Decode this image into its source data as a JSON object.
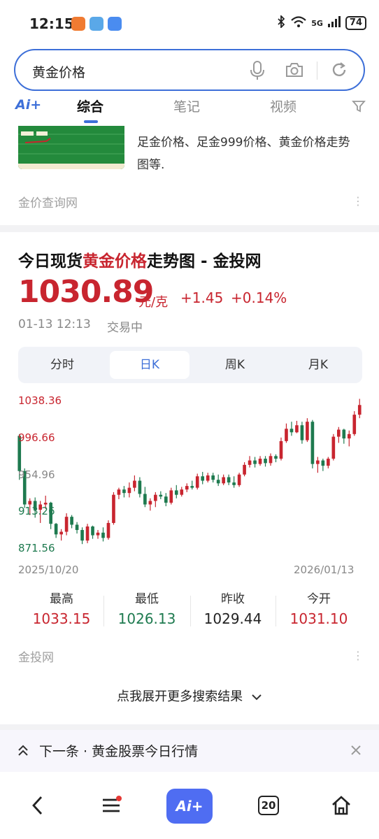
{
  "status_bar": {
    "time": "12:15",
    "network": "5G",
    "battery": "74"
  },
  "search": {
    "query": "黄金价格"
  },
  "tabs": {
    "ai_label": "Ai+",
    "items": [
      "综合",
      "笔记",
      "视频"
    ]
  },
  "card1": {
    "snippet": "足金价格、足金999价格、黄金价格走势图等.",
    "source": "金价查询网"
  },
  "card2": {
    "title_prefix": "今日现货",
    "title_highlight": "黄金价格",
    "title_suffix": "走势图 - 金投网",
    "price": "1030.89",
    "unit": "元/克",
    "change": "+1.45",
    "change_pct": "+0.14%",
    "timestamp": "01-13 12:13",
    "trade_status": "交易中",
    "periods": [
      "分时",
      "日K",
      "周K",
      "月K"
    ],
    "active_period": "日K",
    "start_date": "2025/10/20",
    "end_date": "2026/01/13",
    "stats": [
      {
        "label": "最高",
        "value": "1033.15",
        "color": "#c8252f"
      },
      {
        "label": "最低",
        "value": "1026.13",
        "color": "#1e7a4f"
      },
      {
        "label": "昨收",
        "value": "1029.44",
        "color": "#222222"
      },
      {
        "label": "今开",
        "value": "1031.10",
        "color": "#c8252f"
      }
    ],
    "source": "金投网",
    "expand_label": "点我展开更多搜索结果"
  },
  "next": {
    "label": "下一条 · 黄金股票今日行情"
  },
  "bottom_nav": {
    "ai_label": "Ai+",
    "tab_count": "20"
  },
  "colors": {
    "up": "#c8252f",
    "down": "#1e7a4f",
    "accent": "#3d6fd8"
  },
  "chart_data": {
    "type": "candlestick",
    "y_ticks": [
      "1038.36",
      "996.66",
      "954.96",
      "913.26",
      "871.56"
    ],
    "ylim": [
      871.56,
      1038.36
    ],
    "x_start": "2025/10/20",
    "x_end": "2026/01/13",
    "candles": [
      [
        996,
        998,
        946,
        956
      ],
      [
        956,
        959,
        914,
        918
      ],
      [
        918,
        925,
        906,
        922
      ],
      [
        922,
        926,
        903,
        912
      ],
      [
        912,
        922,
        897,
        918
      ],
      [
        918,
        928,
        913,
        920
      ],
      [
        920,
        921,
        890,
        896
      ],
      [
        896,
        897,
        880,
        884
      ],
      [
        884,
        890,
        877,
        887
      ],
      [
        887,
        908,
        883,
        904
      ],
      [
        904,
        906,
        891,
        895
      ],
      [
        895,
        898,
        885,
        889
      ],
      [
        889,
        892,
        873,
        877
      ],
      [
        877,
        896,
        874,
        893
      ],
      [
        893,
        894,
        879,
        883
      ],
      [
        883,
        889,
        879,
        886
      ],
      [
        886,
        892,
        876,
        880
      ],
      [
        880,
        900,
        878,
        897
      ],
      [
        897,
        932,
        895,
        929
      ],
      [
        929,
        937,
        924,
        935
      ],
      [
        935,
        939,
        926,
        931
      ],
      [
        931,
        943,
        926,
        937
      ],
      [
        937,
        951,
        933,
        945
      ],
      [
        945,
        949,
        926,
        930
      ],
      [
        930,
        938,
        915,
        918
      ],
      [
        918,
        925,
        911,
        922
      ],
      [
        922,
        932,
        915,
        929
      ],
      [
        929,
        933,
        924,
        927
      ],
      [
        927,
        931,
        916,
        920
      ],
      [
        920,
        937,
        918,
        934
      ],
      [
        934,
        940,
        925,
        929
      ],
      [
        929,
        938,
        927,
        935
      ],
      [
        935,
        942,
        932,
        939
      ],
      [
        939,
        945,
        935,
        937
      ],
      [
        937,
        953,
        935,
        950
      ],
      [
        950,
        955,
        941,
        945
      ],
      [
        945,
        954,
        943,
        951
      ],
      [
        951,
        954,
        943,
        946
      ],
      [
        946,
        952,
        939,
        942
      ],
      [
        942,
        952,
        940,
        949
      ],
      [
        949,
        952,
        940,
        943
      ],
      [
        943,
        950,
        937,
        940
      ],
      [
        940,
        954,
        938,
        952
      ],
      [
        952,
        966,
        950,
        963
      ],
      [
        963,
        973,
        960,
        968
      ],
      [
        968,
        972,
        960,
        964
      ],
      [
        964,
        973,
        962,
        970
      ],
      [
        970,
        973,
        961,
        965
      ],
      [
        965,
        976,
        962,
        973
      ],
      [
        973,
        975,
        966,
        970
      ],
      [
        970,
        994,
        968,
        990
      ],
      [
        990,
        1010,
        988,
        1004
      ],
      [
        1004,
        1012,
        996,
        1000
      ],
      [
        1000,
        1013,
        999,
        1008
      ],
      [
        1008,
        1012,
        987,
        991
      ],
      [
        991,
        1016,
        989,
        1012
      ],
      [
        1012,
        1014,
        959,
        964
      ],
      [
        964,
        972,
        954,
        968
      ],
      [
        968,
        970,
        956,
        962
      ],
      [
        962,
        972,
        959,
        970
      ],
      [
        970,
        998,
        968,
        995
      ],
      [
        995,
        1006,
        988,
        1003
      ],
      [
        1003,
        1004,
        987,
        993
      ],
      [
        993,
        1002,
        984,
        998
      ],
      [
        998,
        1024,
        996,
        1020
      ],
      [
        1020,
        1038,
        1016,
        1031
      ]
    ]
  }
}
